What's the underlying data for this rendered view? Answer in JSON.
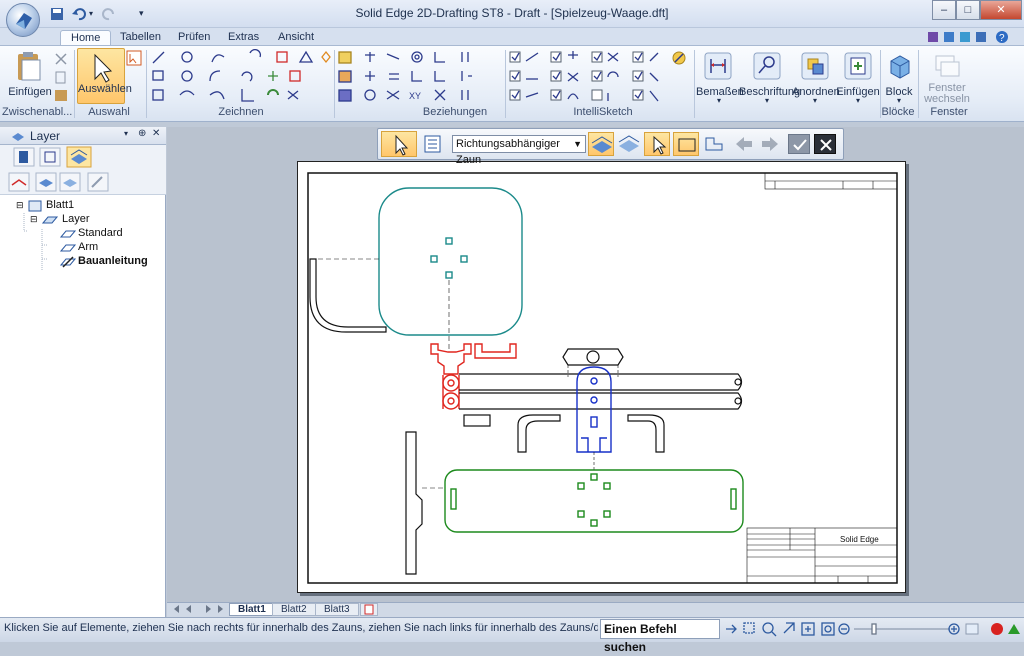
{
  "window": {
    "title": "Solid Edge 2D-Drafting ST8 - Draft - [Spielzeug-Waage.dft]",
    "controls": [
      "–",
      "□",
      "✕"
    ]
  },
  "tabs": [
    {
      "label": "Home",
      "active": true
    },
    {
      "label": "Tabellen"
    },
    {
      "label": "Prüfen"
    },
    {
      "label": "Extras"
    },
    {
      "label": "Ansicht"
    }
  ],
  "ribbon": {
    "groups": {
      "clipboard": "Zwischenabl...",
      "select": "Auswahl",
      "draw": "Zeichnen",
      "relations": "Beziehungen",
      "intellisketch": "IntelliSketch",
      "block": "Blöcke",
      "window": "Fenster"
    },
    "buttons": {
      "paste": "Einfügen",
      "select": "Auswählen",
      "dimension": "Bemaßen",
      "annotation": "Beschriftung",
      "arrange": "Anordnen",
      "insert": "Einfügen",
      "block": "Block",
      "switch_window_1": "Fenster",
      "switch_window_2": "wechseln"
    }
  },
  "left_panel": {
    "title": "Layer",
    "pin": "⊕",
    "close": "✕",
    "tree": [
      {
        "label": "Blatt1",
        "level": 0,
        "expander": "⊟"
      },
      {
        "label": "Layer",
        "level": 1,
        "expander": "⊟"
      },
      {
        "label": "Standard",
        "level": 2
      },
      {
        "label": "Arm",
        "level": 2
      },
      {
        "label": "Bauanleitung",
        "level": 2,
        "bold": true
      }
    ]
  },
  "context_toolbar": {
    "fence_mode": "Richtungsabhängiger Zaun"
  },
  "sheet_tabs": [
    {
      "label": "Blatt1",
      "active": true
    },
    {
      "label": "Blatt2"
    },
    {
      "label": "Blatt3"
    }
  ],
  "title_block": {
    "company": "Solid Edge"
  },
  "status": {
    "message": "Klicken Sie auf Elemente, ziehen Sie nach rechts für innerhalb des Zauns, ziehen Sie nach links für innerhalb des Zauns/den Zaun übe",
    "command_search": "Einen Befehl suchen"
  },
  "colors": {
    "teal": "#1b8a8a",
    "red": "#e0261f",
    "blue": "#1730c8",
    "green": "#1d8a1d",
    "accent": "#ffc66b"
  }
}
